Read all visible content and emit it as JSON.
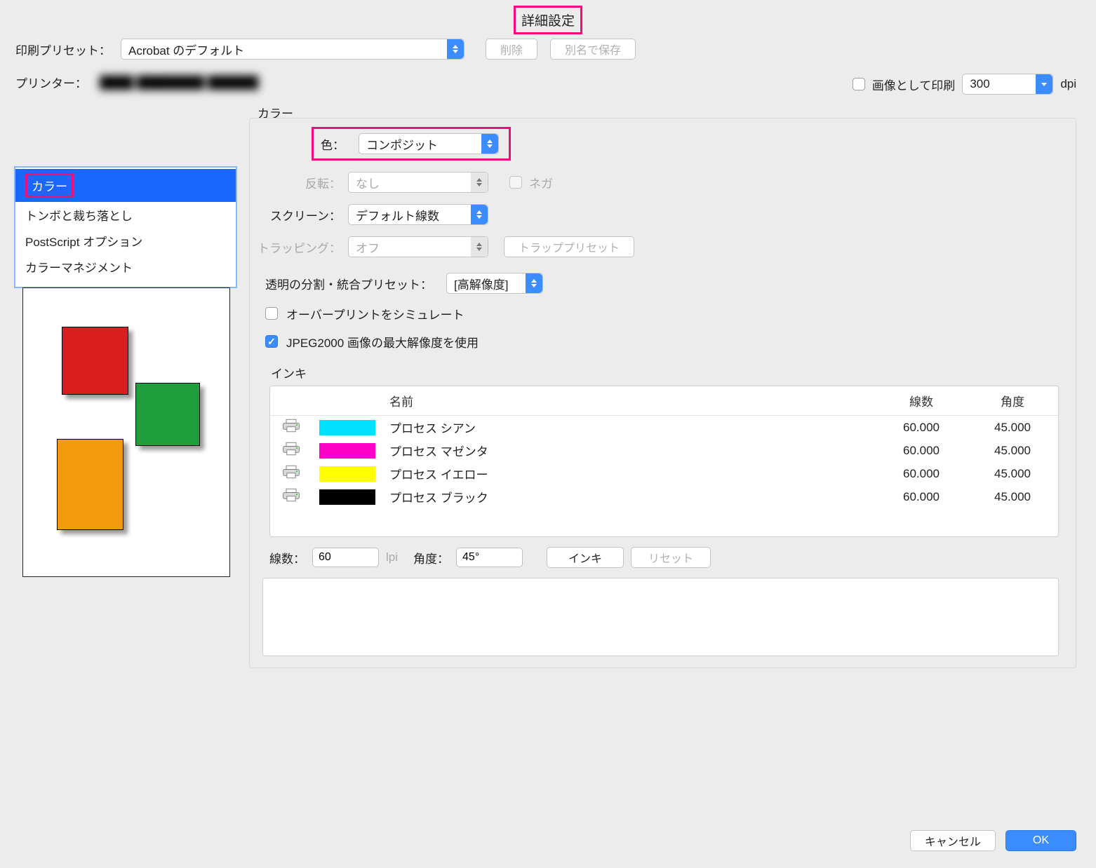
{
  "dialog_title": "詳細設定",
  "preset": {
    "label": "印刷プリセット：",
    "value": "Acrobat のデフォルト",
    "delete": "削除",
    "save_as": "別名で保存"
  },
  "printer": {
    "label": "プリンター：",
    "name": "████ ████████ ██████"
  },
  "print_as_image": {
    "label": "画像として印刷",
    "dpi": "300",
    "dpi_unit": "dpi"
  },
  "section": "カラー",
  "sidebar": {
    "items": [
      "カラー",
      "トンボと裁ち落とし",
      "PostScript オプション",
      "カラーマネジメント"
    ]
  },
  "color_panel": {
    "color_label": "色：",
    "color_value": "コンポジット",
    "invert_label": "反転：",
    "invert_value": "なし",
    "nega": "ネガ",
    "screen_label": "スクリーン：",
    "screen_value": "デフォルト線数",
    "trap_label": "トラッピング：",
    "trap_value": "オフ",
    "trap_btn": "トラッププリセット",
    "flatten_label": "透明の分割・統合プリセット：",
    "flatten_value": "[高解像度]",
    "overprint": "オーバープリントをシミュレート",
    "jpeg2000": "JPEG2000 画像の最大解像度を使用"
  },
  "inks": {
    "label": "インキ",
    "columns": {
      "name": "名前",
      "freq": "線数",
      "angle": "角度"
    },
    "rows": [
      {
        "name": "プロセス シアン",
        "color": "#00e1ff",
        "freq": "60.000",
        "angle": "45.000"
      },
      {
        "name": "プロセス マゼンタ",
        "color": "#ff00c8",
        "freq": "60.000",
        "angle": "45.000"
      },
      {
        "name": "プロセス イエロー",
        "color": "#ffff00",
        "freq": "60.000",
        "angle": "45.000"
      },
      {
        "name": "プロセス ブラック",
        "color": "#000000",
        "freq": "60.000",
        "angle": "45.000"
      }
    ],
    "freq_label": "線数：",
    "freq_value": "60",
    "lpi": "lpi",
    "angle_label": "角度：",
    "angle_value": "45°",
    "ink_btn": "インキ",
    "reset_btn": "リセット"
  },
  "footer": {
    "cancel": "キャンセル",
    "ok": "OK"
  }
}
